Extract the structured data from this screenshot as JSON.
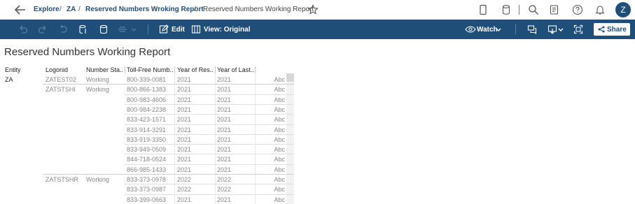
{
  "nav": {
    "breadcrumb": [
      "Explore",
      "ZA",
      "Reserved Numbers Wroking Report"
    ],
    "current": "Reserved Numbers Working Report",
    "separator": "/",
    "avatar_initial": "Z"
  },
  "toolbar": {
    "edit_label": "Edit",
    "view_label": "View: Original",
    "watch_label": "Watch",
    "share_label": "Share"
  },
  "report": {
    "title": "Reserved Numbers Working Report",
    "columns": [
      "Entity",
      "Logonid",
      "Number Sta..",
      "Toll-Free Numb..",
      "Year of Res..",
      "Year of Last.."
    ],
    "entity": "ZA",
    "rows": [
      {
        "logonid": "ZATEST02",
        "status": "Working",
        "number": "800-339-0081",
        "year_res": "2021",
        "year_last": "2021",
        "abc": "Abc"
      },
      {
        "logonid": "ZATSTSHI",
        "status": "Working",
        "number": "800-866-1383",
        "year_res": "2021",
        "year_last": "2021",
        "abc": "Abc"
      },
      {
        "logonid": "",
        "status": "",
        "number": "800-983-4606",
        "year_res": "2021",
        "year_last": "2021",
        "abc": "Abc"
      },
      {
        "logonid": "",
        "status": "",
        "number": "800-984-2238",
        "year_res": "2021",
        "year_last": "2021",
        "abc": "Abc"
      },
      {
        "logonid": "",
        "status": "",
        "number": "833-423-1571",
        "year_res": "2021",
        "year_last": "2021",
        "abc": "Abc"
      },
      {
        "logonid": "",
        "status": "",
        "number": "833-914-3291",
        "year_res": "2021",
        "year_last": "2021",
        "abc": "Abc"
      },
      {
        "logonid": "",
        "status": "",
        "number": "833-919-3350",
        "year_res": "2021",
        "year_last": "2021",
        "abc": "Abc"
      },
      {
        "logonid": "",
        "status": "",
        "number": "833-949-0509",
        "year_res": "2021",
        "year_last": "2021",
        "abc": "Abc"
      },
      {
        "logonid": "",
        "status": "",
        "number": "844-718-0524",
        "year_res": "2021",
        "year_last": "2021",
        "abc": "Abc"
      },
      {
        "logonid": "",
        "status": "",
        "number": "866-985-1433",
        "year_res": "2021",
        "year_last": "2021",
        "abc": "Abc"
      },
      {
        "logonid": "ZATSTSHR",
        "status": "Working",
        "number": "833-373-0978",
        "year_res": "2022",
        "year_last": "2022",
        "abc": "Abc"
      },
      {
        "logonid": "",
        "status": "",
        "number": "833-373-0987",
        "year_res": "2022",
        "year_last": "2022",
        "abc": "Abc"
      },
      {
        "logonid": "",
        "status": "",
        "number": "833-399-0663",
        "year_res": "2021",
        "year_last": "2021",
        "abc": "Abc"
      }
    ]
  },
  "colors": {
    "brand": "#1f4e79",
    "text": "#333333",
    "muted": "#888888"
  }
}
